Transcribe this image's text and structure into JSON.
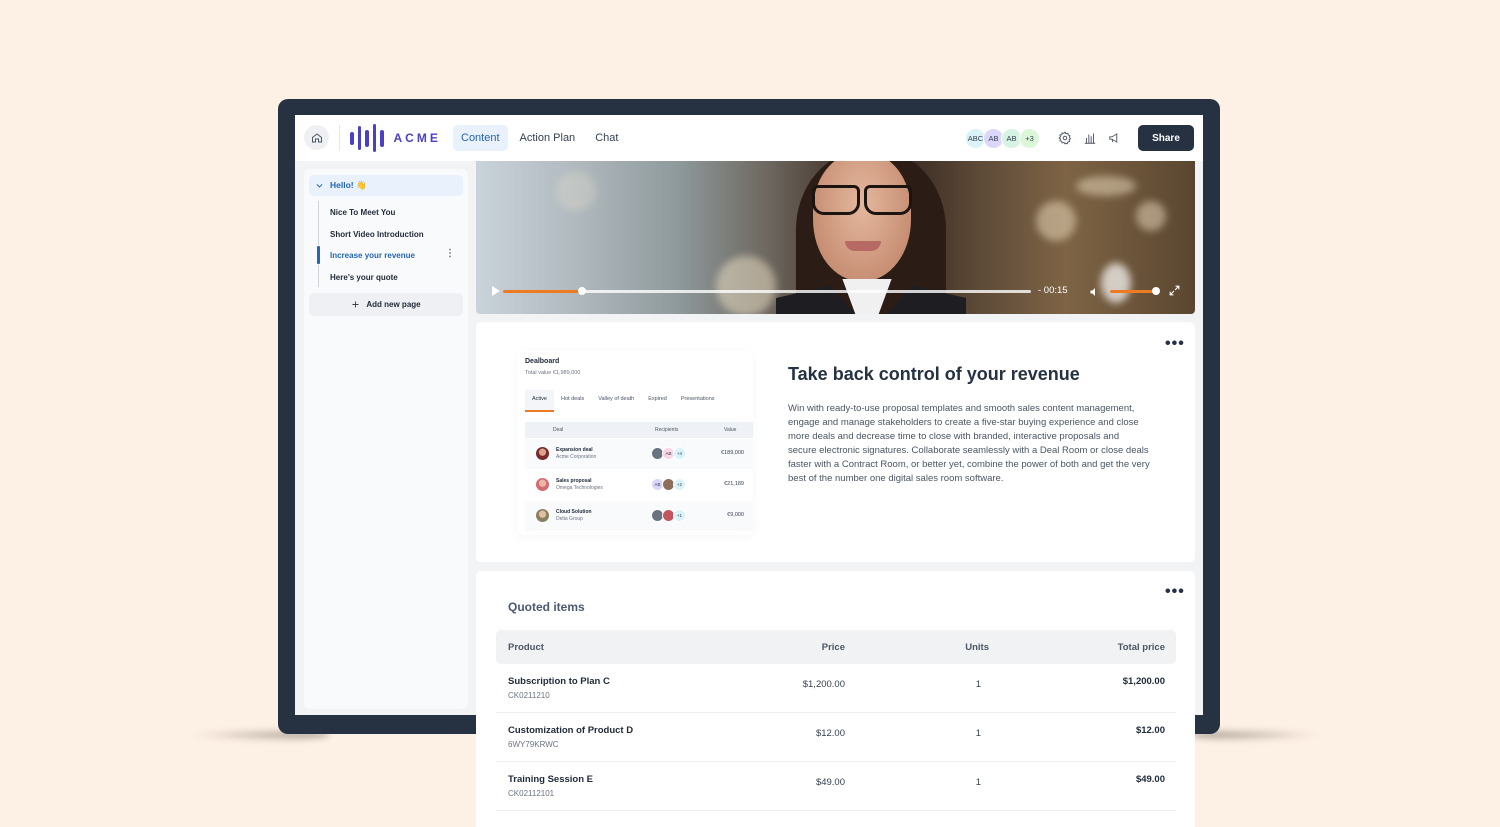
{
  "app": {
    "brand": "ACME",
    "colors": {
      "accent": "#2566b5",
      "brand": "#4b3fc4",
      "dark": "#263142",
      "progress": "#ee7b22",
      "background": "#fdf0e4"
    }
  },
  "topbar": {
    "home_icon": "home-icon",
    "tabs": [
      {
        "label": "Content",
        "active": true
      },
      {
        "label": "Action Plan",
        "active": false
      },
      {
        "label": "Chat",
        "active": false
      }
    ],
    "collaborators": [
      {
        "initials": "ABC",
        "color": "#d9f3f8"
      },
      {
        "initials": "AB",
        "color": "#ddd6fb"
      },
      {
        "initials": "AB",
        "color": "#d6f3e3"
      },
      {
        "initials": "+3",
        "color": "#dcf7d8"
      }
    ],
    "icons": [
      "gear-icon",
      "bar-chart-icon",
      "megaphone-icon"
    ],
    "share_label": "Share"
  },
  "sidebar": {
    "section": {
      "label": "Hello! 👋",
      "expanded": true
    },
    "pages": [
      {
        "label": "Nice To Meet You",
        "active": false
      },
      {
        "label": "Short Video Introduction",
        "active": false
      },
      {
        "label": "Increase your revenue",
        "active": true
      },
      {
        "label": "Here’s your quote",
        "active": false
      }
    ],
    "add_page_label": "Add new page",
    "kebab": "⋮"
  },
  "video": {
    "progress_fraction": 0.15,
    "time_remaining": "- 00:15",
    "volume_fraction": 1.0
  },
  "hero": {
    "more": "•••",
    "title": "Take back control of your revenue",
    "body": "Win with ready-to-use proposal templates and smooth sales content management, engage and manage stakeholders to create a five-star buying experience and close more deals and decrease time to close with branded, interactive proposals and secure electronic signatures. Collaborate seamlessly with a Deal Room or close deals faster with a Contract Room, or better yet, combine the power of both and get the very best of the number one digital sales room software.",
    "dealboard": {
      "title": "Dealboard",
      "subtitle": "Total value €1,989,000",
      "tabs": [
        "Active",
        "Hot deals",
        "Valley of death",
        "Expired",
        "Presentations"
      ],
      "columns": [
        "Deal",
        "Recipients",
        "Value"
      ],
      "rows": [
        {
          "deal": "Expansion deal",
          "company": "Acme Corporation",
          "recipients": [
            "photo",
            "AB",
            "+4"
          ],
          "value": "€189,000"
        },
        {
          "deal": "Sales proposal",
          "company": "Omega Technologies",
          "recipients": [
            "AB",
            "photo",
            "+2"
          ],
          "value": "€21,189"
        },
        {
          "deal": "Cloud Solution",
          "company": "Delta Group",
          "recipients": [
            "photo",
            "photo",
            "+1"
          ],
          "value": "€9,000"
        }
      ]
    }
  },
  "quote": {
    "more": "•••",
    "title": "Quoted items",
    "columns": {
      "product": "Product",
      "price": "Price",
      "units": "Units",
      "total": "Total price"
    },
    "rows": [
      {
        "name": "Subscription to Plan C",
        "sku": "CK0211210",
        "price": "$1,200.00",
        "units": "1",
        "total": "$1,200.00"
      },
      {
        "name": "Customization of Product D",
        "sku": "6WY79KRWC",
        "price": "$12.00",
        "units": "1",
        "total": "$12.00"
      },
      {
        "name": "Training Session E",
        "sku": "CK02112101",
        "price": "$49.00",
        "units": "1",
        "total": "$49.00"
      }
    ]
  }
}
